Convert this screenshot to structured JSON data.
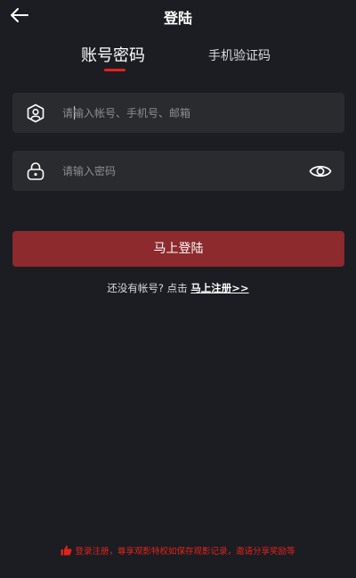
{
  "header": {
    "title": "登陆"
  },
  "tabs": [
    {
      "label": "账号密码",
      "active": true
    },
    {
      "label": "手机验证码",
      "active": false
    }
  ],
  "form": {
    "account_placeholder": "请输入帐号、手机号、邮箱",
    "account_value": "",
    "password_placeholder": "请输入密码",
    "password_value": ""
  },
  "actions": {
    "login_label": "马上登陆",
    "register_prompt": "还没有帐号? 点击",
    "register_link": "马上注册>>"
  },
  "footer": {
    "notice": "登录注册，尊享观影特权如保存观影记录，邀请分享奖励等"
  },
  "colors": {
    "background": "#1c1d23",
    "input_bg": "#2a2b2f",
    "accent": "#e2231a",
    "button": "#8c2a2d"
  },
  "icons": {
    "back": "arrow-left-icon",
    "account": "user-shield-icon",
    "password": "lock-icon",
    "eye": "eye-icon",
    "thumb": "thumbs-up-icon"
  }
}
